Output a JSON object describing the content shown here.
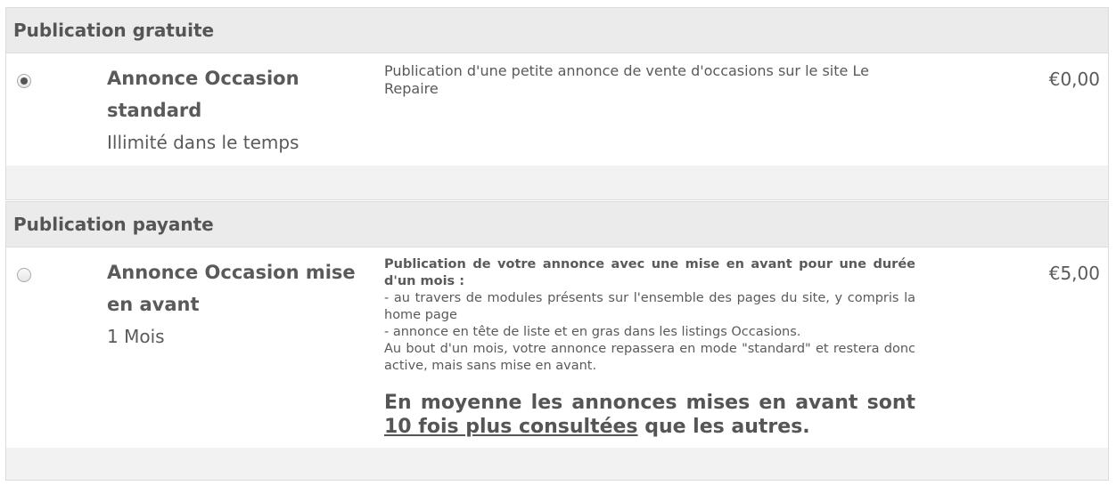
{
  "sections": [
    {
      "header": "Publication gratuite",
      "option": {
        "name": "Annonce Occasion standard",
        "duration": "Illimité dans le temps",
        "description": "Publication d'une petite annonce de vente d'occasions sur le site Le Repaire",
        "price": "€0,00",
        "selected": true
      }
    },
    {
      "header": "Publication payante",
      "option": {
        "name": "Annonce Occasion mise en avant",
        "duration": "1 Mois",
        "description_bold": "Publication de votre annonce avec une mise en avant pour une durée d'un mois :",
        "description_lines": [
          "- au travers de modules présents sur l'ensemble des pages du site, y compris la home page",
          "- annonce en tête de liste et en gras dans les listings Occasions.",
          "Au bout d'un mois, votre annonce repassera en mode \"standard\" et restera donc active, mais sans mise en avant."
        ],
        "highlight_before": "En moyenne les annonces mises en avant sont ",
        "highlight_underlined": "10 fois plus consultées",
        "highlight_after": " que les autres.",
        "price": "€5,00",
        "selected": false
      }
    }
  ]
}
